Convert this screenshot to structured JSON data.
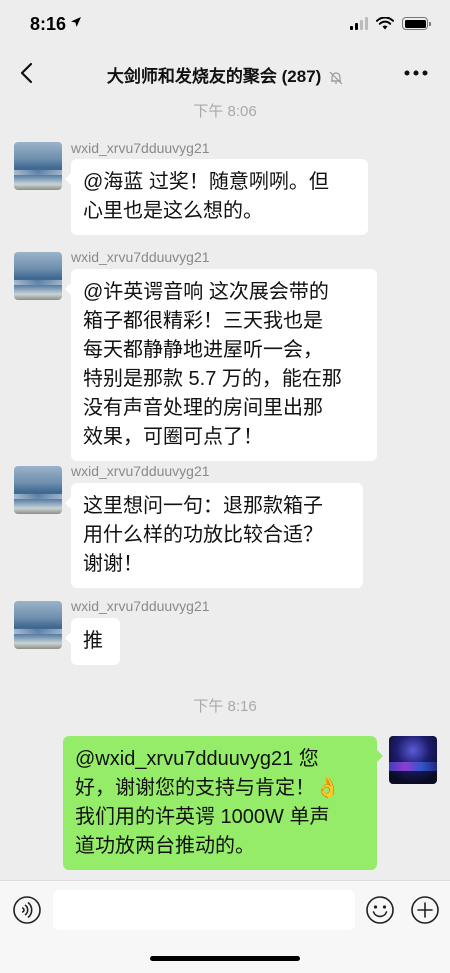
{
  "status_bar": {
    "time": "8:16"
  },
  "nav": {
    "title": "大剑师和发烧友的聚会 (287)"
  },
  "messages": [
    {
      "type": "timestamp",
      "text": "下午 8:06"
    },
    {
      "type": "received",
      "sender": "wxid_xrvu7dduuvyg21",
      "lines": [
        "@海蓝 过奖！随意咧咧。但",
        "心里也是这么想的。"
      ]
    },
    {
      "type": "received",
      "sender": "wxid_xrvu7dduuvyg21",
      "lines": [
        "@许英谔音响 这次展会带的",
        "箱子都很精彩！三天我也是",
        "每天都静静地进屋听一会，",
        "特别是那款 5.7 万的，能在那",
        "没有声音处理的房间里出那",
        "效果，可圈可点了！"
      ]
    },
    {
      "type": "received",
      "sender": "wxid_xrvu7dduuvyg21",
      "lines": [
        "这里想问一句：退那款箱子",
        "用什么样的功放比较合适？",
        "谢谢！"
      ]
    },
    {
      "type": "received",
      "sender": "wxid_xrvu7dduuvyg21",
      "lines": [
        "推"
      ]
    },
    {
      "type": "timestamp",
      "text": "下午 8:16"
    },
    {
      "type": "sent",
      "lines": [
        "@wxid_xrvu7dduuvyg21 您",
        "好，谢谢您的支持与肯定！👌",
        "我们用的许英谔 1000W 单声",
        "道功放两台推动的。"
      ]
    }
  ],
  "input": {
    "value": "",
    "placeholder": ""
  },
  "colors": {
    "background": "#ededed",
    "sent_bubble": "#95ec69",
    "received_bubble": "#ffffff",
    "timestamp_text": "#a9a9a9"
  },
  "icons": [
    "back-arrow-icon",
    "mute-icon",
    "more-icon",
    "voice-icon",
    "emoji-icon",
    "plus-icon"
  ]
}
